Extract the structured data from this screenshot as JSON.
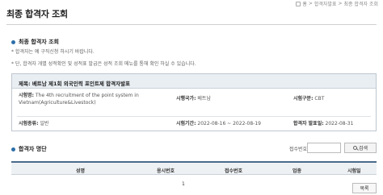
{
  "page": {
    "title": "최종 합격자 조회",
    "breadcrumb": [
      "홈",
      "합격자발표",
      "최종 합격자 조회"
    ],
    "breadcrumb_separator": ">"
  },
  "section1": {
    "heading": "최종 합격자 조회",
    "notes": [
      "합격자는 예 구직신청 하시기 바랍니다.",
      "단, 합격자 개별 성적확인 및 성적표 발급은 성적 조회 메뉴를 통해 확인 하실 수 있습니다."
    ]
  },
  "info": {
    "title": "제목: 베트남 제1회 외국인력 포인트제 합격자발표",
    "exam_name_label": "시험명:",
    "exam_name_value": "The 4th recruitment of the point system in Vietnam(Agriculture&Livestock)",
    "country_label": "시행국가:",
    "country_value": "베트남",
    "division_label": "시험구분:",
    "division_value": "CBT",
    "type_label": "시험종류:",
    "type_value": "일반",
    "period_label": "시험기간:",
    "period_value": "2022-08-16 ~ 2022-08-19",
    "announce_label": "합격자 발표일:",
    "announce_value": "2022-08-31"
  },
  "section2": {
    "heading": "합격자 명단",
    "search_label": "접수번호:",
    "search_value": "",
    "search_button": "검색",
    "columns": [
      "성명",
      "응시번호",
      "접수번호",
      "업종",
      "시험일"
    ],
    "result_value": "1",
    "list_button": "목록"
  },
  "colors": {
    "accent": "#2d6fa8",
    "table_border": "#4a6a8a",
    "header_bg": "#eef1f4"
  }
}
